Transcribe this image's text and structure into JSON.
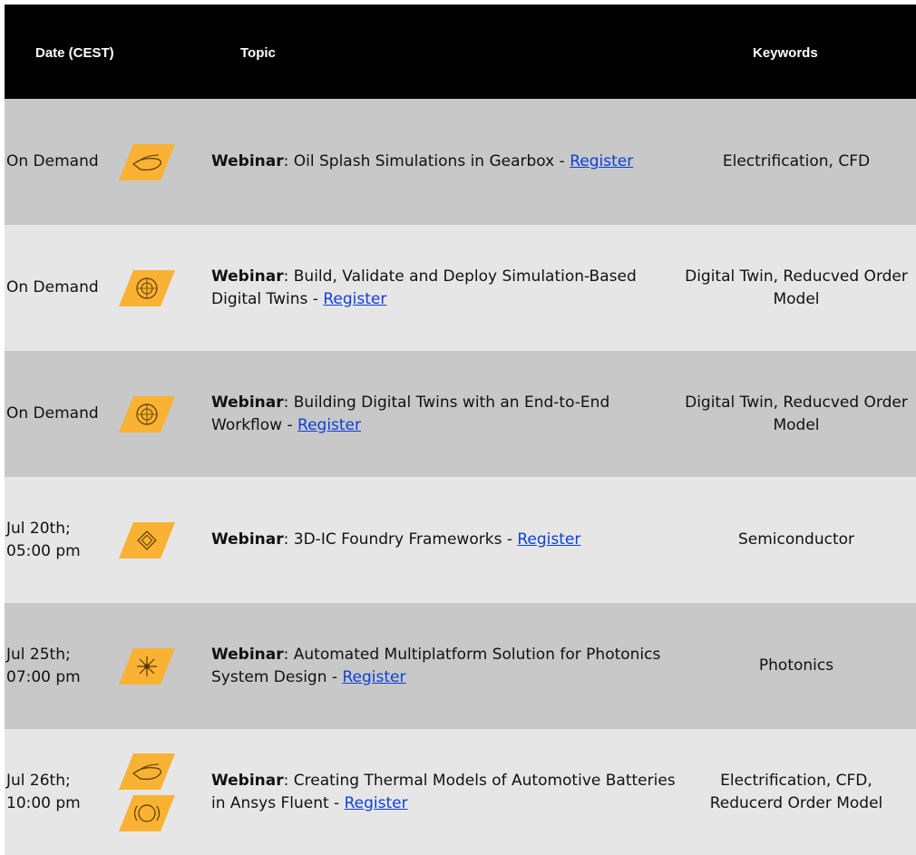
{
  "header": {
    "date": "Date (CEST)",
    "topic": "Topic",
    "keywords": "Keywords"
  },
  "colors": {
    "header_bg": "#000000",
    "row_dark": "#c8c8c8",
    "row_light": "#e6e6e6",
    "accent": "#f9b233",
    "link": "#0b3fd8"
  },
  "rows": [
    {
      "date1": "On Demand",
      "date2": "",
      "icons": [
        "gearbox-splash-icon"
      ],
      "type": "Webinar",
      "title": ": Oil Splash Simulations in Gearbox - ",
      "link": "Register",
      "keywords": "Electrification, CFD"
    },
    {
      "date1": "On Demand",
      "date2": "",
      "icons": [
        "digital-twin-icon"
      ],
      "type": "Webinar",
      "title": ": Build, Validate and Deploy Simulation-Based Digital Twins - ",
      "link": "Register",
      "keywords": "Digital Twin, Reducved Order Model"
    },
    {
      "date1": "On Demand",
      "date2": "",
      "icons": [
        "digital-twin-icon"
      ],
      "type": "Webinar",
      "title": ": Building Digital Twins with an End-to-End Workflow - ",
      "link": "Register",
      "keywords": "Digital Twin, Reducved Order Model"
    },
    {
      "date1": "Jul 20th;",
      "date2": "05:00 pm",
      "icons": [
        "semiconductor-chip-icon"
      ],
      "type": "Webinar",
      "title": ": 3D-IC Foundry Frameworks - ",
      "link": "Register",
      "keywords": "Semiconductor"
    },
    {
      "date1": "Jul 25th;",
      "date2": "07:00 pm",
      "icons": [
        "photonics-burst-icon"
      ],
      "type": "Webinar",
      "title": ": Automated Multiplatform Solution for Photonics System Design - ",
      "link": "Register",
      "keywords": "Photonics"
    },
    {
      "date1": "Jul 26th;",
      "date2": "10:00 pm",
      "icons": [
        "gearbox-splash-icon",
        "reduced-order-model-icon"
      ],
      "type": "Webinar",
      "title": ": Creating Thermal Models of Automotive Batteries in Ansys Fluent - ",
      "link": "Register",
      "keywords": "Electrification, CFD, Reducerd Order Model"
    }
  ]
}
